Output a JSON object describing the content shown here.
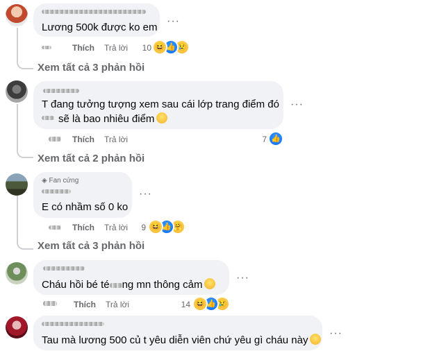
{
  "comments": [
    {
      "text": "Lương 500k được ko em",
      "actions": {
        "like": "Thích",
        "reply": "Trả lời"
      },
      "reaction_count": "10",
      "reactions": [
        "haha-icon",
        "like-icon",
        "sad-icon"
      ],
      "view_replies": "Xem tất cả 3 phản hồi"
    },
    {
      "text_line1": "T đang tưởng tượng xem sau cái lớp trang điểm đó",
      "text_line2": "sẽ là bao nhiêu điểm",
      "actions": {
        "like": "Thích",
        "reply": "Trả lời"
      },
      "reaction_count": "7",
      "reactions": [
        "like-icon"
      ],
      "view_replies": "Xem tất cả 2 phản hồi"
    },
    {
      "badge": "Fan cứng",
      "text": "E có nhầm số 0 ko",
      "actions": {
        "like": "Thích",
        "reply": "Trả lời"
      },
      "reaction_count": "9",
      "reactions": [
        "haha-icon",
        "like-icon",
        "care-icon"
      ],
      "view_replies": "Xem tất cả 3 phản hồi"
    },
    {
      "text_a": "Cháu hồi bé té",
      "text_b": "ng mn thông cảm",
      "actions": {
        "like": "Thích",
        "reply": "Trả lời"
      },
      "reaction_count": "14",
      "reactions": [
        "haha-icon",
        "like-icon",
        "sad-icon"
      ]
    },
    {
      "text": "Tau mà lương 500 củ t yêu diễn viên chứ yêu gì cháu này"
    }
  ],
  "more_label": "···",
  "colors": {
    "bubble": "#f0f2f5",
    "secondary": "#65676b",
    "like_blue": "#0866ff",
    "haha_yellow": "#f7b125"
  }
}
